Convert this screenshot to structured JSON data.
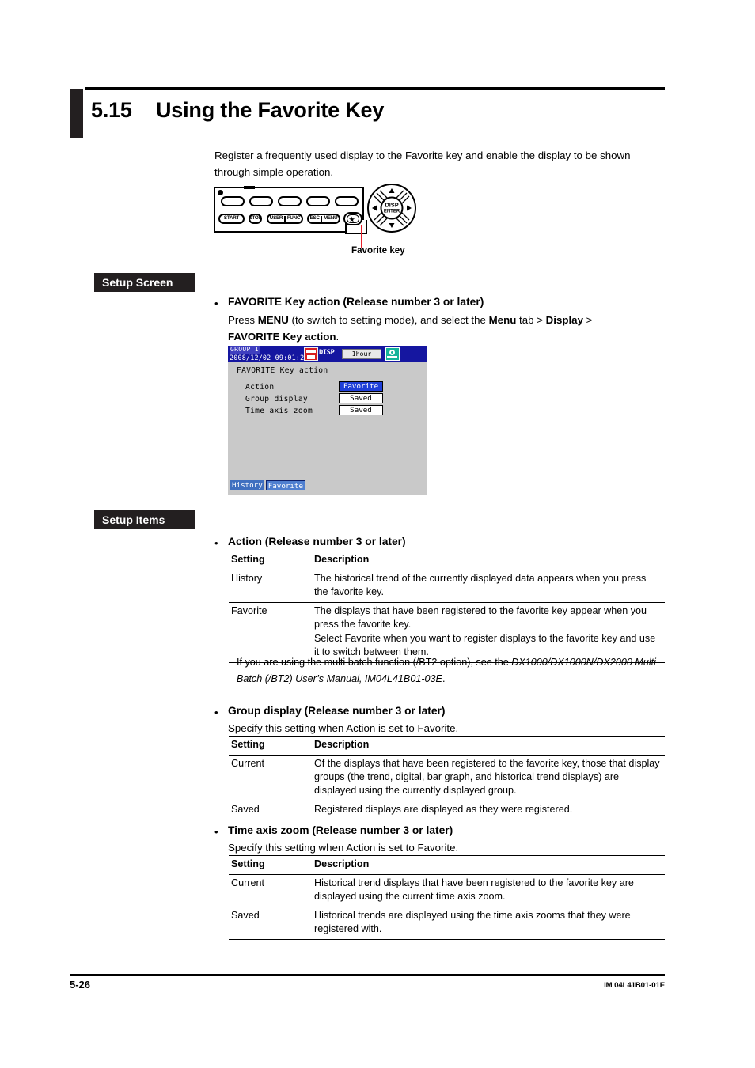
{
  "page": {
    "section_number": "5.15",
    "section_title": "Using the Favorite Key",
    "intro": "Register a frequently used display to the Favorite key and enable the display to be shown through simple operation.",
    "footer_page": "5-26",
    "footer_doc": "IM 04L41B01-01E"
  },
  "keypad": {
    "callout_label": "Favorite key",
    "buttons": {
      "start": "START",
      "stop": "STOP",
      "user": "USER",
      "func": "FUNC",
      "esc": "ESC",
      "menu": "MENU",
      "disp_enter_top": "DISP",
      "disp_enter_bottom": "ENTER"
    }
  },
  "setup_screen": {
    "banner": "Setup Screen",
    "bullet_title": "FAVORITE Key action (Release number 3 or later)",
    "instruction_parts": {
      "p1": "Press ",
      "menu": "MENU",
      "p2": " (to switch to setting mode), and select the ",
      "menu_tab": "Menu",
      "p3": " tab > ",
      "display": "Display",
      "p4": " >",
      "p5": "FAVORITE Key action",
      "p6": "."
    }
  },
  "lcd": {
    "group_label": "GROUP 1",
    "datetime": "2008/12/02 09:01:22",
    "disp_label": "DISP",
    "time_span": "1hour",
    "heading": "FAVORITE Key action",
    "rows": [
      {
        "label": "Action",
        "value": "Favorite",
        "selected": true
      },
      {
        "label": "Group display",
        "value": "Saved",
        "selected": false
      },
      {
        "label": "Time axis zoom",
        "value": "Saved",
        "selected": false
      }
    ],
    "tabs": [
      "History",
      "Favorite"
    ],
    "colors": {
      "titlebar": "#1516a0",
      "body": "#c9c9c9",
      "selected_value": "#1f3fd8",
      "record_icon": "#d81e20",
      "gear_icon": "#14b39a"
    }
  },
  "setup_items": {
    "banner": "Setup Items",
    "note": {
      "plain1": "If you are using the multi batch function (/BT2 option), see the ",
      "italic1": "DX1000/DX1000N/DX2000 Multi Batch (/BT2) User’s Manual, IM04L41B01-03E",
      "plain2": "."
    },
    "sections": [
      {
        "bullet_title": "Action (Release number 3 or later)",
        "subtitle": "",
        "headers": [
          "Setting",
          "Description"
        ],
        "rows": [
          {
            "setting": "History",
            "paragraphs": [
              "The historical trend of the currently displayed data appears when you press the favorite key."
            ]
          },
          {
            "setting": "Favorite",
            "paragraphs": [
              "The displays that have been registered to the favorite key appear when you press the favorite key.",
              "Select Favorite when you want to register displays to the favorite key and use it to switch between them."
            ]
          }
        ]
      },
      {
        "bullet_title": "Group display (Release number 3 or later)",
        "subtitle": "Specify this setting when Action is set to Favorite.",
        "headers": [
          "Setting",
          "Description"
        ],
        "rows": [
          {
            "setting": "Current",
            "paragraphs": [
              "Of the displays that have been registered to the favorite key, those that display groups (the trend, digital, bar graph, and historical trend displays) are displayed using the currently displayed group."
            ]
          },
          {
            "setting": "Saved",
            "paragraphs": [
              "Registered displays are displayed as they were registered."
            ]
          }
        ]
      },
      {
        "bullet_title": "Time axis zoom (Release number 3 or later)",
        "subtitle": "Specify this setting when Action is set to Favorite.",
        "headers": [
          "Setting",
          "Description"
        ],
        "rows": [
          {
            "setting": "Current",
            "paragraphs": [
              "Historical trend displays that have been registered to the favorite key are displayed using the current time axis zoom."
            ]
          },
          {
            "setting": "Saved",
            "paragraphs": [
              "Historical trends are displayed using the time axis zooms that they were registered with."
            ]
          }
        ]
      }
    ]
  }
}
